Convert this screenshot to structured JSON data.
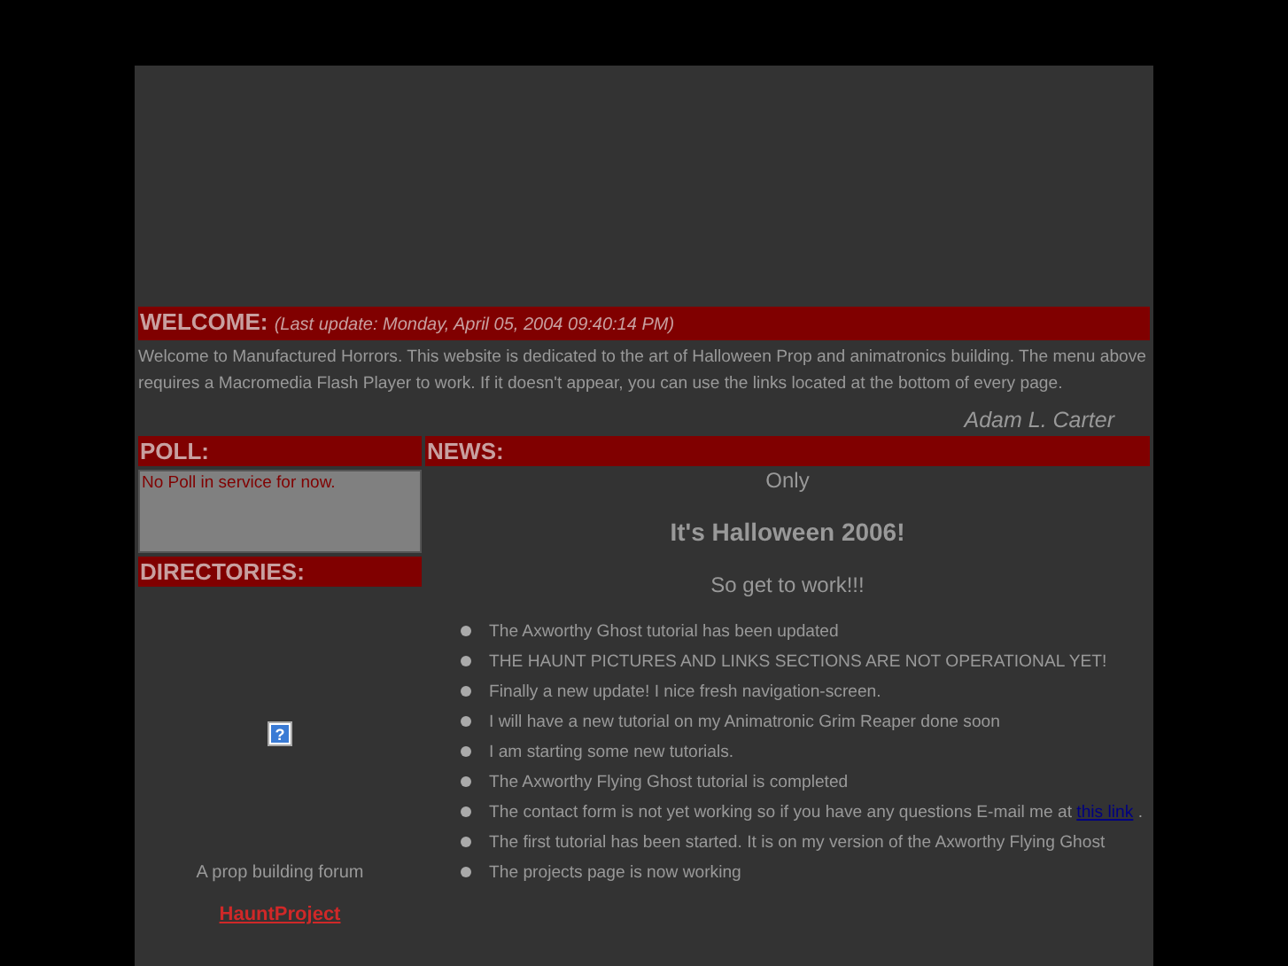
{
  "welcome": {
    "heading": "WELCOME:",
    "last_update": "(Last update: Monday, April 05, 2004 09:40:14 PM)",
    "text": "Welcome to Manufactured Horrors. This website is dedicated to the art of Halloween Prop and animatronics building. The menu above requires a Macromedia Flash Player to work. If it doesn't appear, you can use the links located at the bottom of every page.",
    "signature": "Adam L. Carter"
  },
  "poll": {
    "heading": "POLL:",
    "text": "No Poll in service for now."
  },
  "directories": {
    "heading": "DIRECTORIES:",
    "broken_image_glyph": "?",
    "caption": "A prop building forum",
    "link": "HauntProject"
  },
  "news": {
    "heading": "NEWS:",
    "line_1": "Only",
    "headline": "It's Halloween 2006!",
    "line_2": "So get to work!!!",
    "items": [
      {
        "text": "The Axworthy Ghost tutorial has been updated"
      },
      {
        "text": "THE HAUNT PICTURES AND LINKS SECTIONS ARE NOT OPERATIONAL YET!"
      },
      {
        "text": "Finally a new update! I nice fresh navigation-screen."
      },
      {
        "text": "I will have a new tutorial on my Animatronic Grim Reaper done soon"
      },
      {
        "text": "I am starting some new tutorials."
      },
      {
        "text": "The Axworthy Flying Ghost tutorial is completed"
      },
      {
        "text": "The contact form is not yet working so if you have any questions E-mail me at ",
        "link": "this link",
        "after": " ."
      },
      {
        "text": "The first tutorial has been started. It is on my version of the Axworthy Flying Ghost"
      },
      {
        "text": "The projects page is now working"
      }
    ]
  }
}
